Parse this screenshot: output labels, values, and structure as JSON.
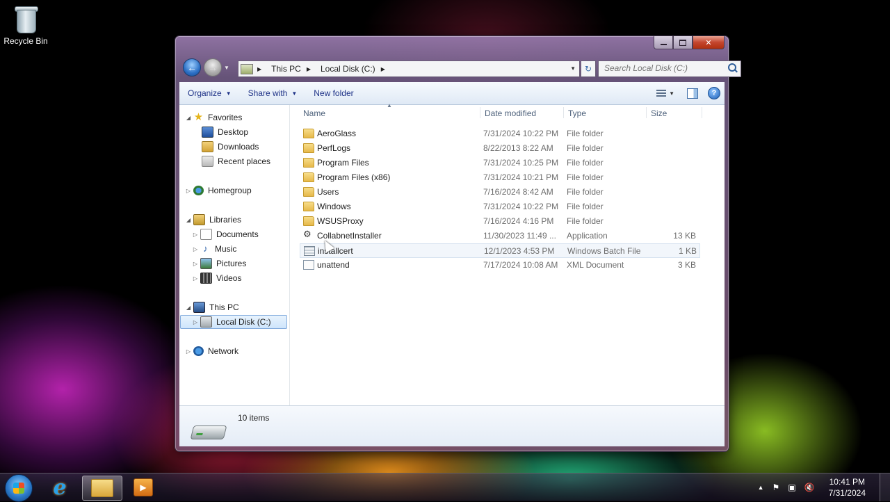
{
  "desktop": {
    "recycle_bin_label": "Recycle Bin"
  },
  "window": {
    "caption_buttons": {
      "minimize": "",
      "maximize": "",
      "close": "✕"
    },
    "address": {
      "crumbs": [
        "This PC",
        "Local Disk (C:)"
      ]
    },
    "search_placeholder": "Search Local Disk (C:)"
  },
  "toolbar": {
    "organize": "Organize",
    "share_with": "Share with",
    "new_folder": "New folder"
  },
  "nav_pane": {
    "favorites": "Favorites",
    "desktop": "Desktop",
    "downloads": "Downloads",
    "recent_places": "Recent places",
    "homegroup": "Homegroup",
    "libraries": "Libraries",
    "documents": "Documents",
    "music": "Music",
    "pictures": "Pictures",
    "videos": "Videos",
    "this_pc": "This PC",
    "local_disk": "Local Disk (C:)",
    "network": "Network"
  },
  "columns": {
    "name": "Name",
    "date": "Date modified",
    "type": "Type",
    "size": "Size"
  },
  "files": [
    {
      "name": "AeroGlass",
      "date": "7/31/2024 10:22 PM",
      "type": "File folder",
      "size": "",
      "icon": "folder-icon"
    },
    {
      "name": "PerfLogs",
      "date": "8/22/2013 8:22 AM",
      "type": "File folder",
      "size": "",
      "icon": "folder-icon"
    },
    {
      "name": "Program Files",
      "date": "7/31/2024 10:25 PM",
      "type": "File folder",
      "size": "",
      "icon": "folder-icon"
    },
    {
      "name": "Program Files (x86)",
      "date": "7/31/2024 10:21 PM",
      "type": "File folder",
      "size": "",
      "icon": "folder-icon"
    },
    {
      "name": "Users",
      "date": "7/16/2024 8:42 AM",
      "type": "File folder",
      "size": "",
      "icon": "folder-icon"
    },
    {
      "name": "Windows",
      "date": "7/31/2024 10:22 PM",
      "type": "File folder",
      "size": "",
      "icon": "folder-icon"
    },
    {
      "name": "WSUSProxy",
      "date": "7/16/2024 4:16 PM",
      "type": "File folder",
      "size": "",
      "icon": "folder-icon"
    },
    {
      "name": "CollabnetInstaller",
      "date": "11/30/2023 11:49 ...",
      "type": "Application",
      "size": "13 KB",
      "icon": "application-icon"
    },
    {
      "name": "installcert",
      "date": "12/1/2023 4:53 PM",
      "type": "Windows Batch File",
      "size": "1 KB",
      "icon": "batch-file-icon"
    },
    {
      "name": "unattend",
      "date": "7/17/2024 10:08 AM",
      "type": "XML Document",
      "size": "3 KB",
      "icon": "xml-document-icon"
    }
  ],
  "status": {
    "item_count": "10 items"
  },
  "taskbar": {
    "time": "10:41 PM",
    "date": "7/31/2024"
  }
}
